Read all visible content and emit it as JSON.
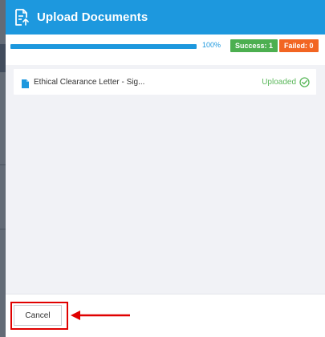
{
  "dialog": {
    "title": "Upload Documents",
    "header_icon": "upload-document-icon",
    "accent_color": "#1d98de"
  },
  "progress": {
    "percent_label": "100%",
    "value": 1.0,
    "success_label": "Success: 1",
    "failed_label": "Failed: 0",
    "success_color": "#4caf50",
    "failed_color": "#f26522"
  },
  "files": [
    {
      "name": "Ethical Clearance Letter - Sig...",
      "status": "Uploaded",
      "icon": "file-icon",
      "status_icon": "check-circle-icon",
      "status_color": "#5cb85c"
    }
  ],
  "footer": {
    "cancel_label": "Cancel",
    "highlight_color": "#e00000"
  }
}
